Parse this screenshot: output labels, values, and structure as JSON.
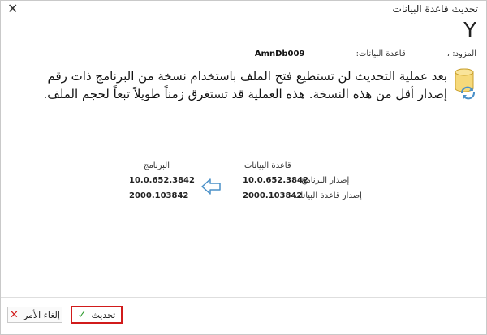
{
  "window": {
    "title": "تحديث قاعدة البيانات"
  },
  "heading": {
    "letter": "Y"
  },
  "provider": {
    "label": "المزود:",
    "provider_value": "،",
    "db_label": "قاعدة البيانات:",
    "db_name": "AmnDb009"
  },
  "message": {
    "text": "بعد عملية التحديث لن تستطيع فتح الملف باستخدام نسخة من البرنامج ذات رقم إصدار أقل من هذه النسخة. هذه العملية قد تستغرق زمناً طويلاً تبعاً لحجم الملف."
  },
  "versions": {
    "database_header": "قاعدة البيانات",
    "program_header": "البرنامج",
    "rows": [
      {
        "label": "إصدار البرنامج",
        "database": "10.0.652.3842",
        "program": "10.0.652.3842"
      },
      {
        "label": "إصدار قاعدة البيانات",
        "database": "2000.103842",
        "program": "2000.103842"
      }
    ]
  },
  "buttons": {
    "update": "تحديث",
    "cancel": "إلغاء الأمر"
  },
  "colors": {
    "highlight": "#d11b1b",
    "check": "#2e9b2e",
    "cross": "#d11b1b",
    "arrow": "#4a90c8"
  },
  "icons": {
    "close": "close-icon",
    "database": "database-sync-icon",
    "arrow": "arrow-left-icon"
  }
}
